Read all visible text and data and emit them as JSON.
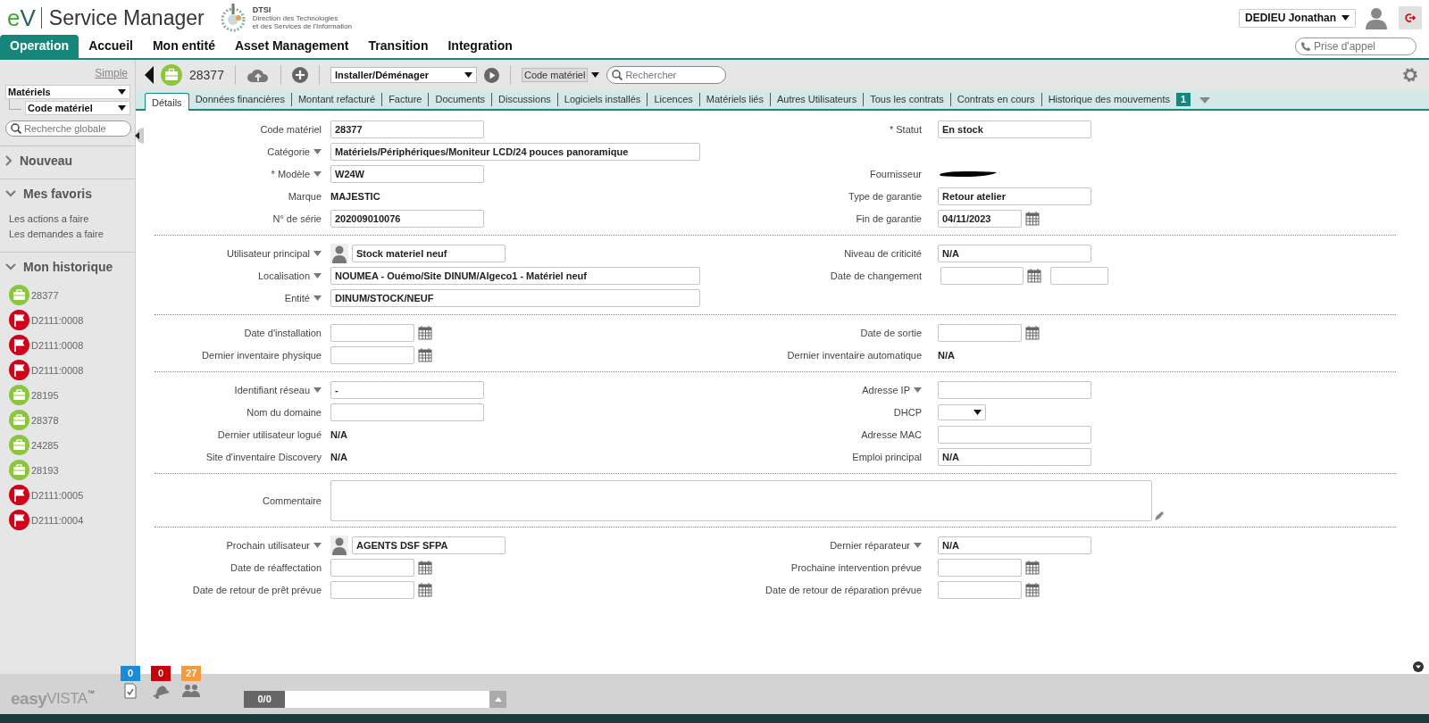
{
  "header": {
    "logo": [
      "e",
      "V"
    ],
    "product": "Service Manager",
    "org": {
      "acronym": "DTSI",
      "lines": [
        "Direction des Technologies",
        "et des Services de l'Information"
      ]
    },
    "user": "DEDIEU Jonathan"
  },
  "nav": [
    {
      "label": "Operation",
      "selected": true
    },
    {
      "label": "Accueil",
      "selected": false
    },
    {
      "label": "Mon entité",
      "selected": false
    },
    {
      "label": "Asset Management",
      "selected": false
    },
    {
      "label": "Transition",
      "selected": false
    },
    {
      "label": "Integration",
      "selected": false
    }
  ],
  "call_field": {
    "placeholder": "Prise d'appel"
  },
  "sidebar": {
    "mode_link": "Simple",
    "domain": "Matériels",
    "search_key": "Code matériel",
    "search": {
      "placeholder": "Recherche globale"
    },
    "sections": [
      {
        "title": "Nouveau",
        "expanded": false
      },
      {
        "title": "Mes favoris",
        "expanded": true,
        "items": [
          {
            "label": "Les actions a faire"
          },
          {
            "label": "Les demandes a faire"
          }
        ]
      },
      {
        "title": "Mon historique",
        "expanded": true,
        "items": [
          {
            "kind": "asset",
            "label": "28377"
          },
          {
            "kind": "request",
            "label": "D2111:0008"
          },
          {
            "kind": "request",
            "label": "D2111:0008"
          },
          {
            "kind": "request",
            "label": "D2111:0008"
          },
          {
            "kind": "asset",
            "label": "28195"
          },
          {
            "kind": "asset",
            "label": "28378"
          },
          {
            "kind": "asset",
            "label": "24285"
          },
          {
            "kind": "asset",
            "label": "28193"
          },
          {
            "kind": "request",
            "label": "D2111:0005"
          },
          {
            "kind": "request",
            "label": "D2111:0004"
          }
        ]
      }
    ]
  },
  "toolbar": {
    "record": "28377",
    "action": "Installer/Déménager",
    "search_by": "Code matériel",
    "search": {
      "placeholder": "Rechercher"
    }
  },
  "tabs": [
    {
      "label": "Détails",
      "selected": true
    },
    {
      "label": "Données financières",
      "selected": false
    },
    {
      "label": "Montant refacturé",
      "selected": false
    },
    {
      "label": "Facture",
      "selected": false
    },
    {
      "label": "Documents",
      "selected": false
    },
    {
      "label": "Discussions",
      "selected": false
    },
    {
      "label": "Logiciels installés",
      "selected": false
    },
    {
      "label": "Licences",
      "selected": false
    },
    {
      "label": "Matériels liés",
      "selected": false
    },
    {
      "label": "Autres Utilisateurs",
      "selected": false
    },
    {
      "label": "Tous les contrats",
      "selected": false
    },
    {
      "label": "Contrats en cours",
      "selected": false
    },
    {
      "label": "Historique des mouvements",
      "selected": false,
      "badge": "1"
    }
  ],
  "form": [
    {
      "rows": [
        {
          "left": {
            "label": "Code matériel",
            "kind": "input",
            "value": "28377"
          },
          "right": {
            "label": "* Statut",
            "kind": "input",
            "value": "En stock"
          }
        },
        {
          "left": {
            "label": "Catégorie",
            "dropdown": true,
            "kind": "input",
            "wide": true,
            "value": "Matériels/Périphériques/Moniteur LCD/24 pouces panoramique"
          }
        },
        {
          "left": {
            "label": "* Modèle",
            "dropdown": true,
            "kind": "input",
            "value": "W24W"
          },
          "right": {
            "label": "Fournisseur",
            "kind": "redacted"
          }
        },
        {
          "left": {
            "label": "Marque",
            "kind": "text",
            "value": "MAJESTIC"
          },
          "right": {
            "label": "Type de garantie",
            "kind": "input",
            "value": "Retour atelier"
          }
        },
        {
          "left": {
            "label": "N° de série",
            "kind": "input",
            "value": "202009010076"
          },
          "right": {
            "label": "Fin de garantie",
            "kind": "date",
            "value": "04/11/2023"
          }
        }
      ]
    },
    {
      "rows": [
        {
          "left": {
            "label": "Utilisateur principal",
            "dropdown": true,
            "person": true,
            "kind": "input",
            "value": "Stock materiel neuf"
          },
          "right": {
            "label": "Niveau de criticité",
            "kind": "input",
            "value": "N/A"
          }
        },
        {
          "left": {
            "label": "Localisation",
            "dropdown": true,
            "kind": "input",
            "wide": true,
            "value": "NOUMEA - Ouémo/Site DINUM/Algeco1 - Matériel neuf"
          },
          "right": {
            "label": "Date de changement",
            "kind": "datetime"
          }
        },
        {
          "left": {
            "label": "Entité",
            "dropdown": true,
            "kind": "input",
            "wide": true,
            "value": "DINUM/STOCK/NEUF"
          }
        }
      ]
    },
    {
      "rows": [
        {
          "left": {
            "label": "Date d'installation",
            "kind": "date"
          },
          "right": {
            "label": "Date de sortie",
            "kind": "date"
          }
        },
        {
          "left": {
            "label": "Dernier inventaire physique",
            "kind": "date"
          },
          "right": {
            "label": "Dernier inventaire automatique",
            "kind": "text",
            "value": "N/A"
          }
        }
      ]
    },
    {
      "rows": [
        {
          "left": {
            "label": "Identifiant réseau",
            "dropdown": true,
            "kind": "input",
            "value": "-"
          },
          "right": {
            "label": "Adresse IP",
            "dropdown": true,
            "kind": "input"
          }
        },
        {
          "left": {
            "label": "Nom du domaine",
            "kind": "input"
          },
          "right": {
            "label": "DHCP",
            "kind": "select"
          }
        },
        {
          "left": {
            "label": "Dernier utilisateur logué",
            "kind": "text",
            "value": "N/A"
          },
          "right": {
            "label": "Adresse MAC",
            "kind": "input"
          }
        },
        {
          "left": {
            "label": "Site d'inventaire Discovery",
            "kind": "text",
            "value": "N/A"
          },
          "right": {
            "label": "Emploi principal",
            "kind": "input",
            "value": "N/A"
          }
        }
      ]
    },
    {
      "rows": [
        {
          "left": {
            "label": "Commentaire",
            "kind": "textarea"
          }
        }
      ]
    },
    {
      "rows": [
        {
          "left": {
            "label": "Prochain utilisateur",
            "dropdown": true,
            "person": true,
            "kind": "input",
            "value": "AGENTS DSF SFPA"
          },
          "right": {
            "label": "Dernier réparateur",
            "dropdown": true,
            "kind": "input",
            "value": "N/A"
          }
        },
        {
          "left": {
            "label": "Date de réaffectation",
            "kind": "date"
          },
          "right": {
            "label": "Prochaine intervention prévue",
            "kind": "date"
          }
        },
        {
          "left": {
            "label": "Date de retour de prêt prévue",
            "kind": "date"
          },
          "right": {
            "label": "Date de retour de réparation prévue",
            "kind": "date"
          }
        }
      ]
    }
  ],
  "footer": {
    "logo": [
      "easy",
      "VISTA",
      "™"
    ],
    "counters": [
      {
        "count": "0",
        "color": "#1b8bd3",
        "kind": "tasks"
      },
      {
        "count": "0",
        "color": "#c8000b",
        "kind": "alerts"
      },
      {
        "count": "27",
        "color": "#f39a3c",
        "kind": "groups"
      }
    ],
    "progress": "0/0",
    "level": 0
  }
}
